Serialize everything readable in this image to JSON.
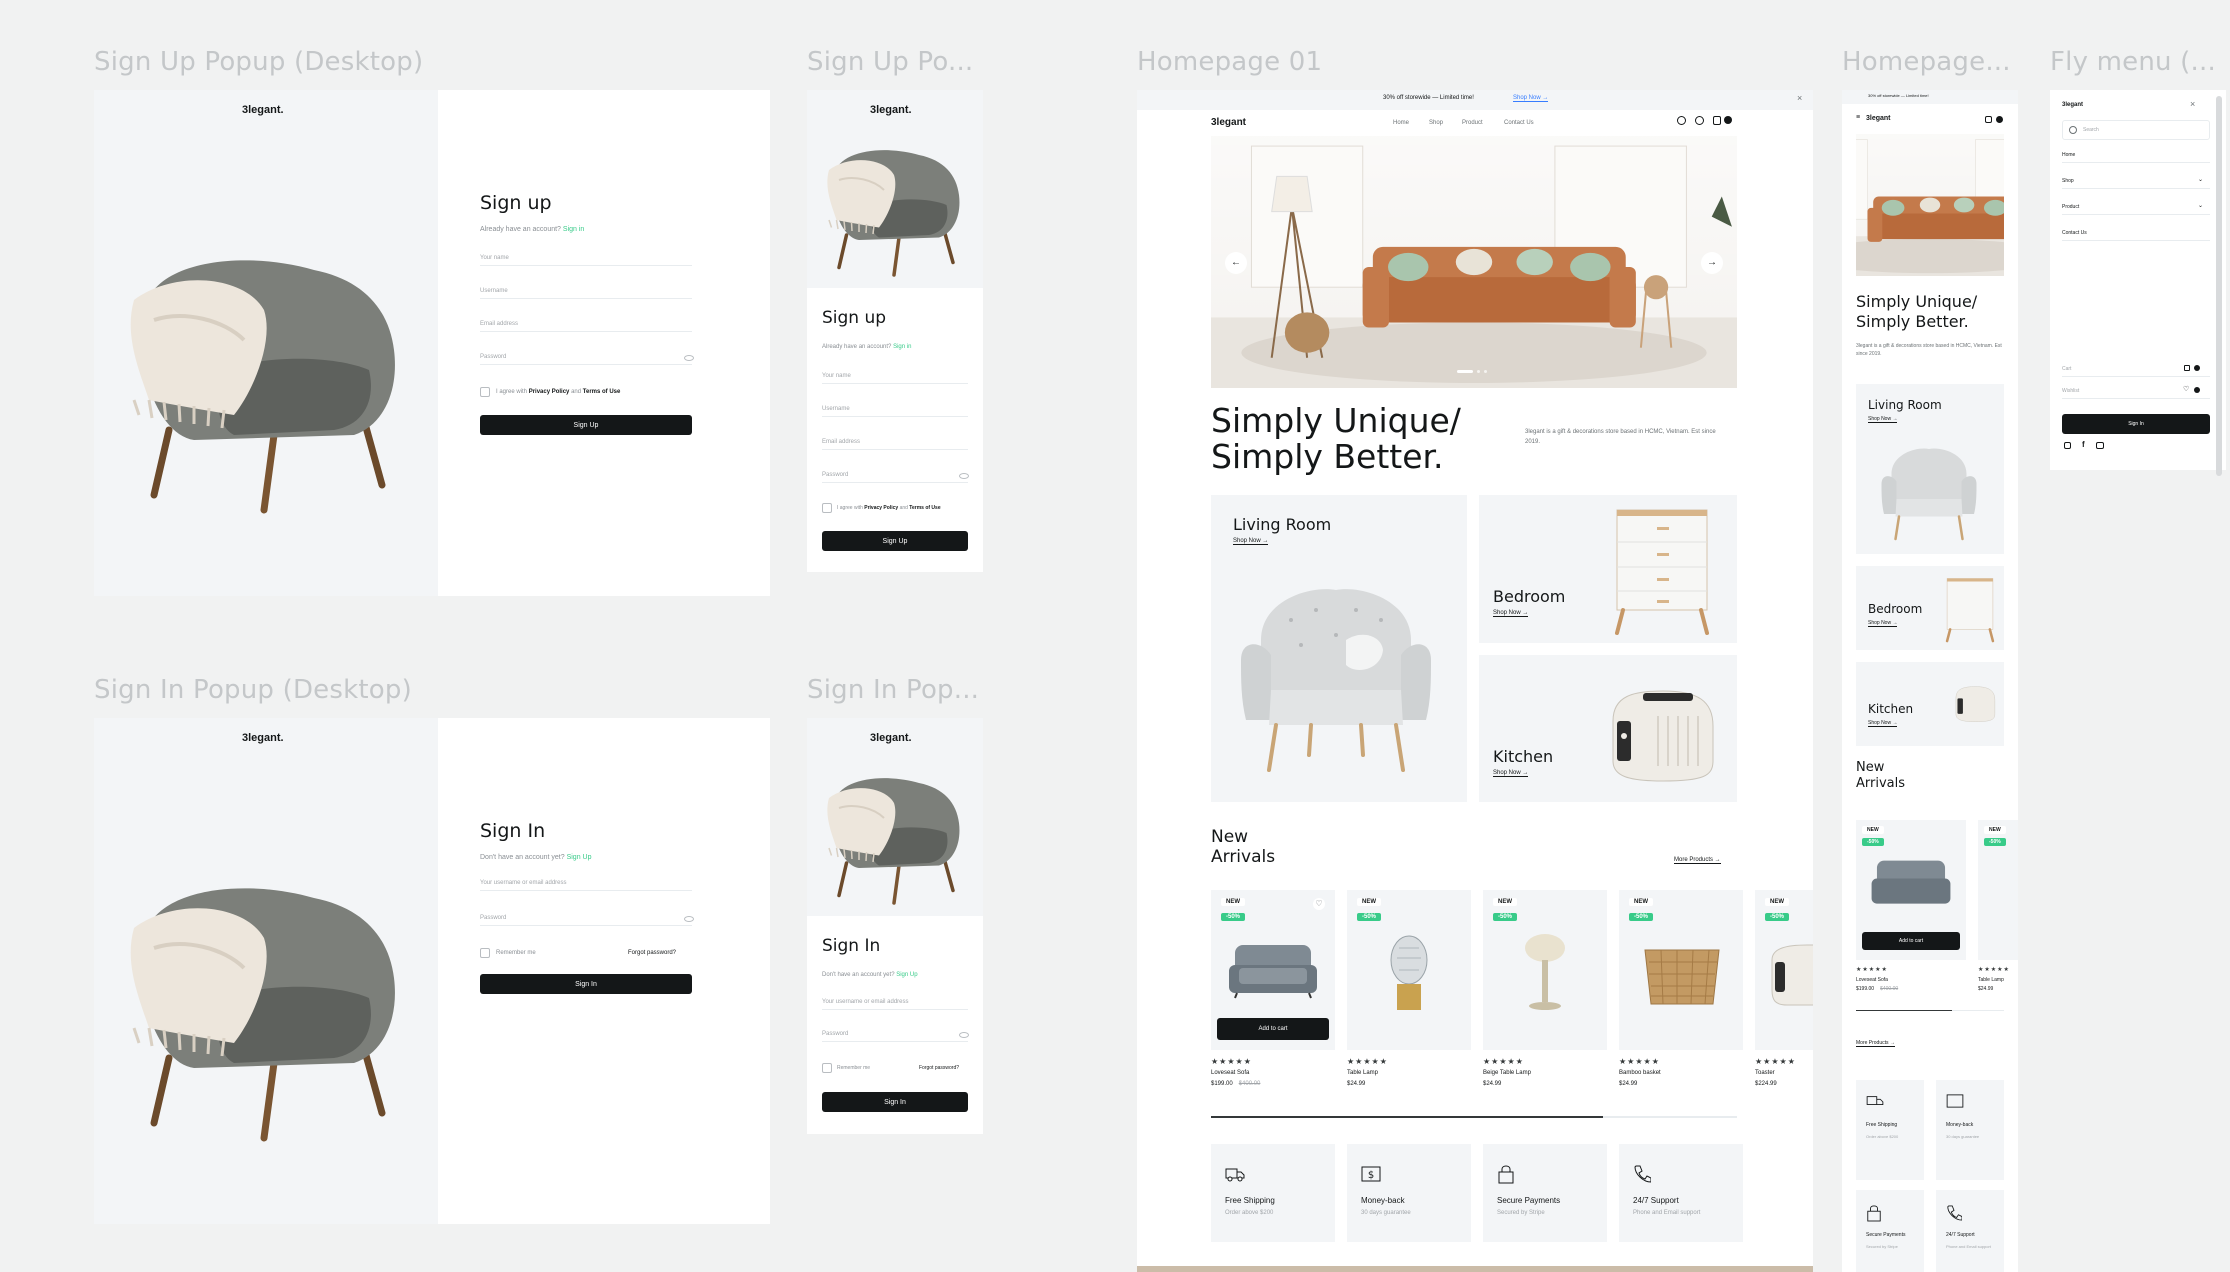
{
  "frames": {
    "signup_desktop": "Sign Up Popup (Desktop)",
    "signup_mobile": "Sign Up Po...",
    "signin_desktop": "Sign In Popup (Desktop)",
    "signin_mobile": "Sign In Pop...",
    "homepage_desktop": "Homepage 01",
    "homepage_mobile": "Homepage...",
    "fly_menu": "Fly menu (..."
  },
  "brand": {
    "logo": "3legant.",
    "logo_short": "3legant",
    "accent": "#38cb89",
    "dark": "#141718"
  },
  "signup": {
    "title": "Sign up",
    "prompt": "Already have an account?",
    "prompt_link": "Sign in",
    "fields": [
      "Your name",
      "Username",
      "Email address",
      "Password"
    ],
    "agree_prefix": "I agree with",
    "agree_link1": "Privacy Policy",
    "agree_and": "and",
    "agree_link2": "Terms of Use",
    "button": "Sign Up"
  },
  "signin": {
    "title": "Sign In",
    "prompt": "Don't have an account yet?",
    "prompt_link": "Sign Up",
    "fields": [
      "Your username or email address",
      "Password"
    ],
    "remember": "Remember me",
    "forgot": "Forgot password?",
    "button": "Sign In"
  },
  "home": {
    "promo": "30% off storewide — Limited time!",
    "promo_link": "Shop Now →",
    "nav": [
      "Home",
      "Shop",
      "Product",
      "Contact Us"
    ],
    "hero_title_1": "Simply Unique/",
    "hero_title_2": "Simply Better.",
    "hero_desc": "3legant is a gift & decorations store based in HCMC, Vietnam. Est since 2019.",
    "categories": [
      {
        "name": "Living Room",
        "link": "Shop Now →"
      },
      {
        "name": "Bedroom",
        "link": "Shop Now →"
      },
      {
        "name": "Kitchen",
        "link": "Shop Now →"
      }
    ],
    "new_arrivals_1": "New",
    "new_arrivals_2": "Arrivals",
    "more_products": "More Products →",
    "products": [
      {
        "badge": "NEW",
        "off": "-50%",
        "name": "Loveseat Sofa",
        "price": "$199.00",
        "old": "$400.00",
        "cart": "Add to cart"
      },
      {
        "badge": "NEW",
        "off": "-50%",
        "name": "Table Lamp",
        "price": "$24.99",
        "old": ""
      },
      {
        "badge": "NEW",
        "off": "-50%",
        "name": "Beige Table Lamp",
        "price": "$24.99",
        "old": ""
      },
      {
        "badge": "NEW",
        "off": "-50%",
        "name": "Bamboo basket",
        "price": "$24.99",
        "old": ""
      },
      {
        "badge": "NEW",
        "off": "-50%",
        "name": "Toaster",
        "price": "$224.99",
        "old": ""
      }
    ],
    "stars": "★★★★★",
    "features": [
      {
        "name": "Free Shipping",
        "sub": "Order above $200"
      },
      {
        "name": "Money-back",
        "sub": "30 days guarantee"
      },
      {
        "name": "Secure Payments",
        "sub": "Secured by Stripe"
      },
      {
        "name": "24/7 Support",
        "sub": "Phone and Email support"
      }
    ]
  },
  "fly": {
    "search": "Search",
    "items": [
      "Home",
      "Shop",
      "Product",
      "Contact Us"
    ],
    "cart": "Cart",
    "wishlist": "Wishlist",
    "button": "Sign In"
  }
}
